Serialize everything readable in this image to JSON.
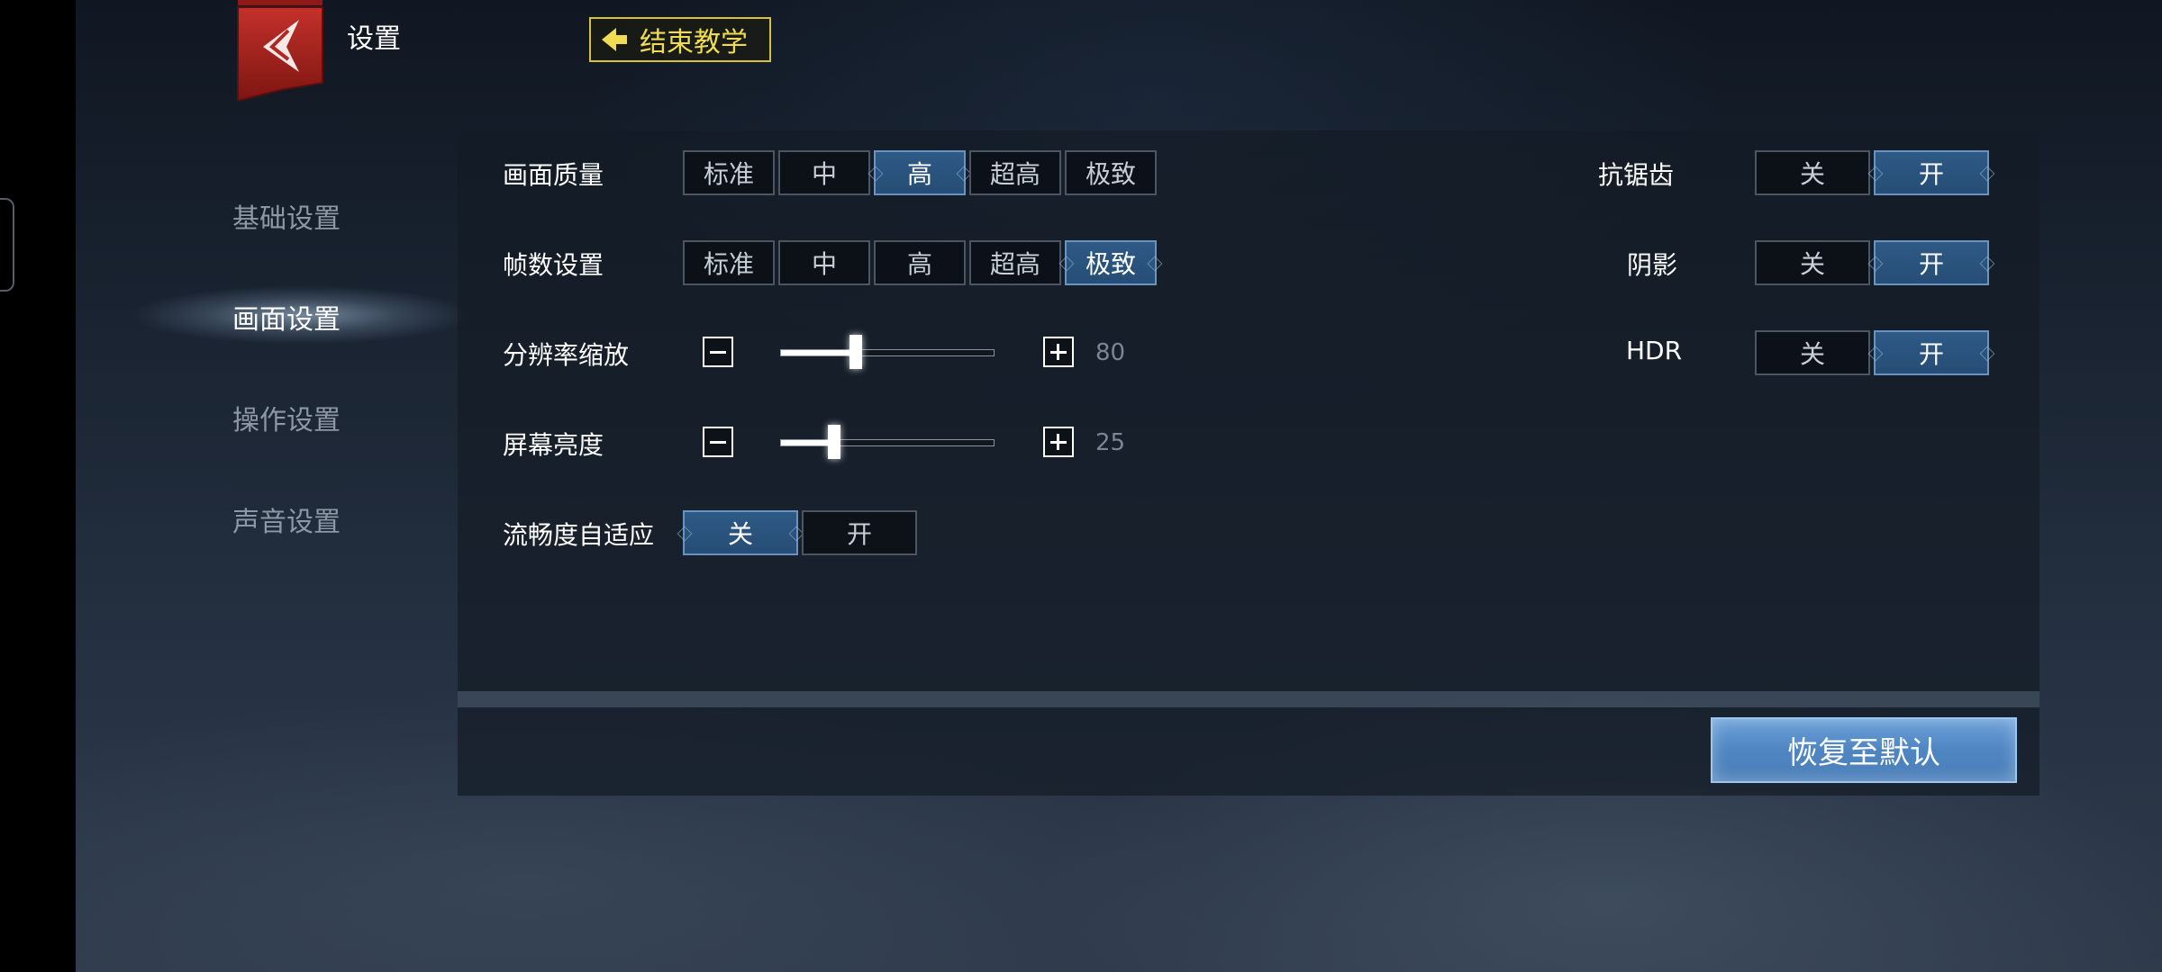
{
  "header": {
    "title": "设置",
    "end_tutorial_label": "结束教学"
  },
  "sidebar": {
    "items": [
      {
        "label": "基础设置",
        "active": false
      },
      {
        "label": "画面设置",
        "active": true
      },
      {
        "label": "操作设置",
        "active": false
      },
      {
        "label": "声音设置",
        "active": false
      }
    ]
  },
  "settings": {
    "quality": {
      "label": "画面质量",
      "options": [
        "标准",
        "中",
        "高",
        "超高",
        "极致"
      ],
      "selected": "高"
    },
    "framerate": {
      "label": "帧数设置",
      "options": [
        "标准",
        "中",
        "高",
        "超高",
        "极致"
      ],
      "selected": "极致"
    },
    "resolution": {
      "label": "分辨率缩放",
      "value": "80",
      "level": 0.35
    },
    "brightness": {
      "label": "屏幕亮度",
      "value": "25",
      "level": 0.25
    },
    "adaptive": {
      "label": "流畅度自适应",
      "off_label": "关",
      "on_label": "开",
      "selected": "关"
    },
    "antialiasing": {
      "label": "抗锯齿",
      "off_label": "关",
      "on_label": "开",
      "selected": "开"
    },
    "shadow": {
      "label": "阴影",
      "off_label": "关",
      "on_label": "开",
      "selected": "开"
    },
    "hdr": {
      "label": "HDR",
      "off_label": "关",
      "on_label": "开",
      "selected": "开"
    }
  },
  "footer": {
    "restore_label": "恢复至默认"
  },
  "colors": {
    "selected_bg": "#2e5a86",
    "accent_yellow": "#f0dc52",
    "restore_button": "#5b90cc",
    "emblem_red": "#a52420"
  }
}
